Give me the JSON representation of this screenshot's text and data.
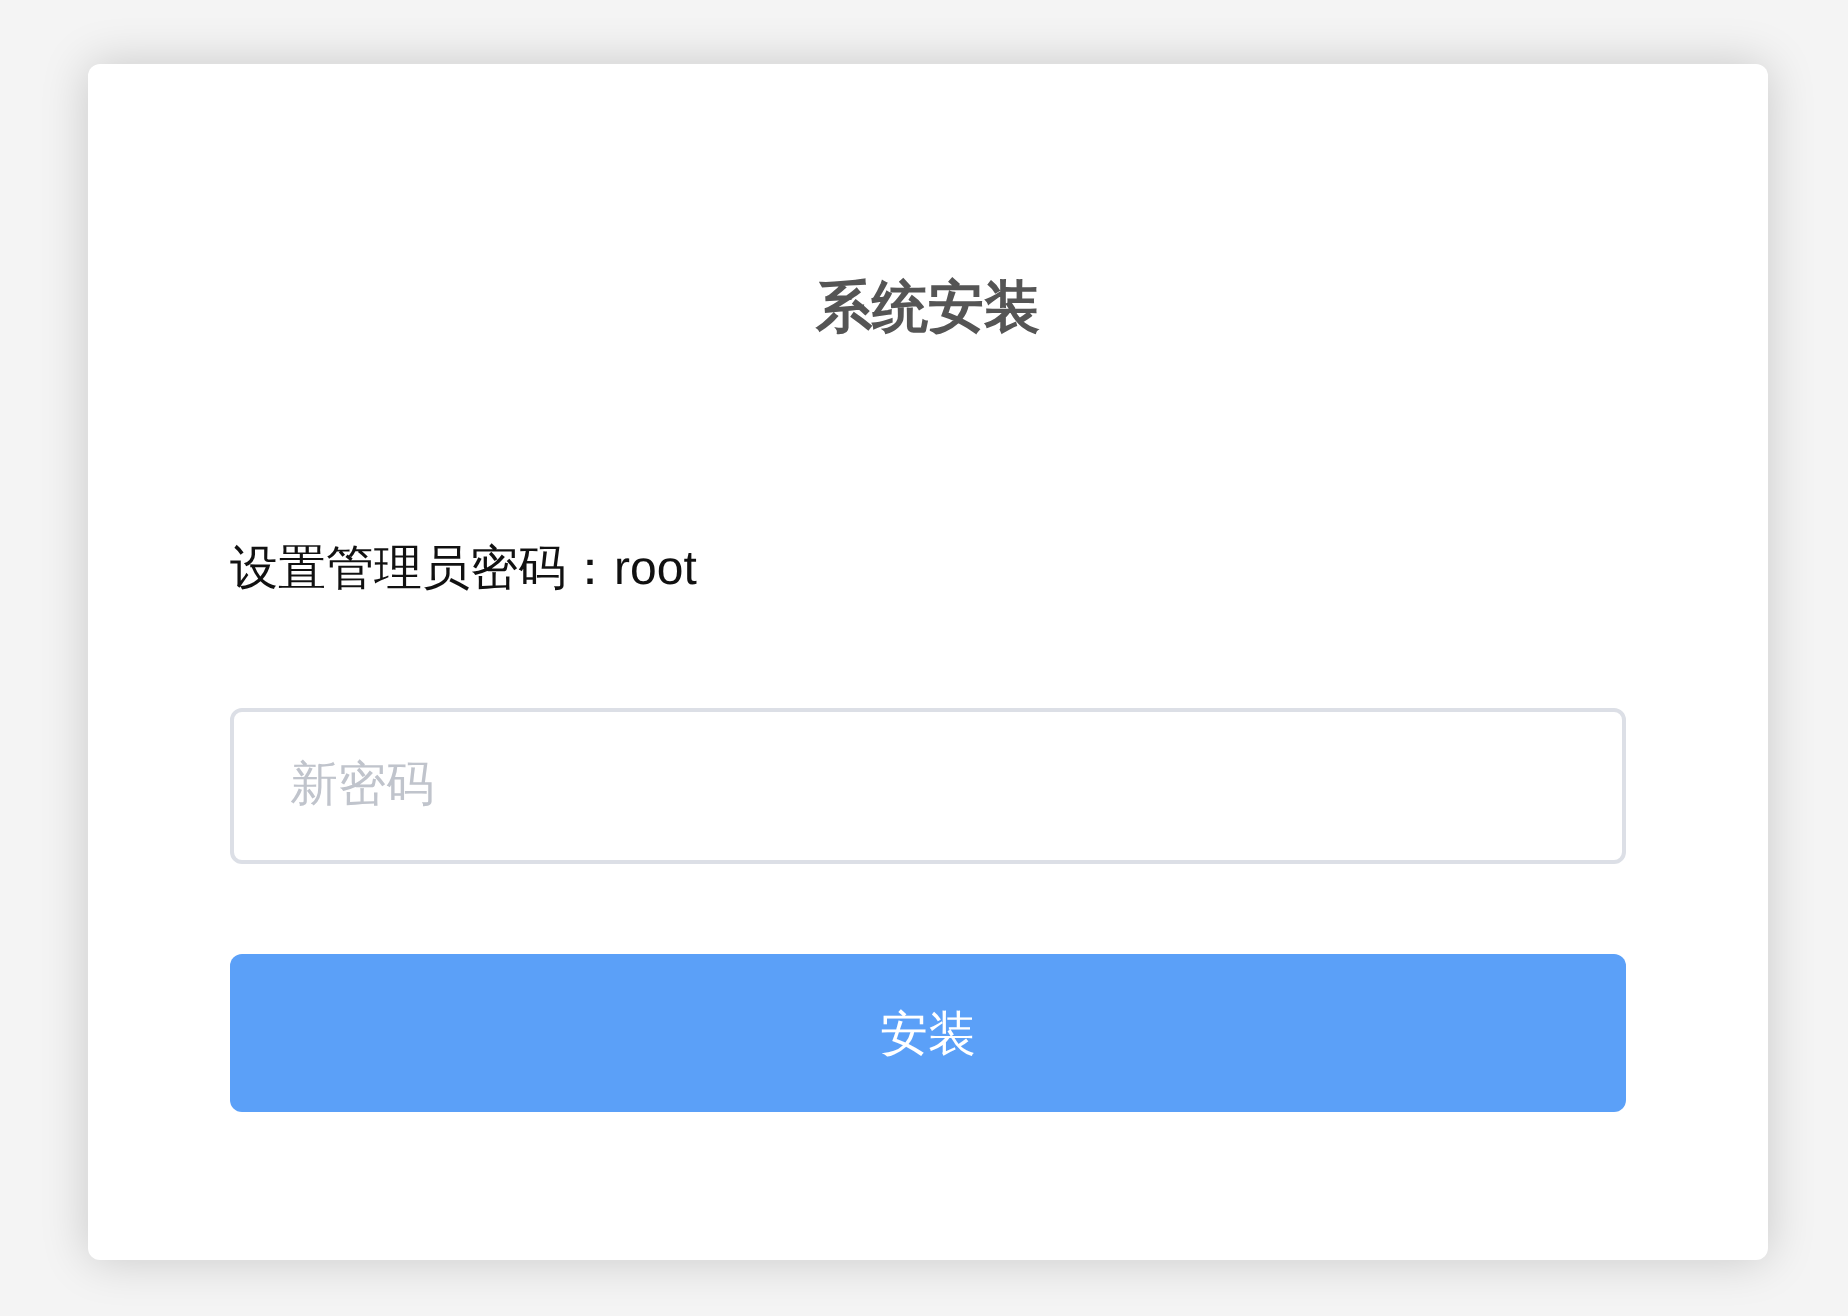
{
  "dialog": {
    "title": "系统安装",
    "label": "设置管理员密码：root",
    "password_field": {
      "placeholder": "新密码"
    },
    "button": "安装"
  }
}
